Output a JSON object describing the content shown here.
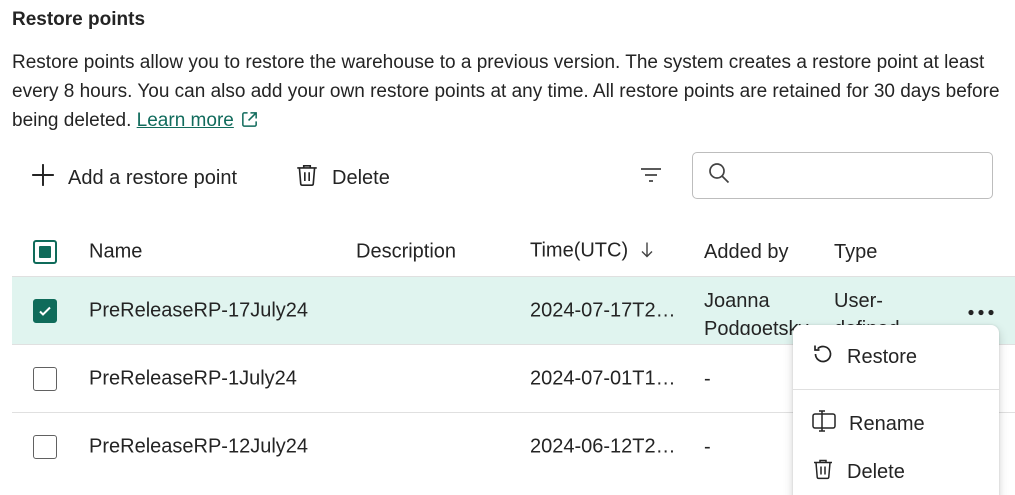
{
  "header": {
    "title": "Restore points",
    "description": "Restore points allow you to restore the warehouse to a previous version. The system creates a restore point at least every 8 hours. You can also add your own restore points at any time. All restore points are retained for 30 days before being deleted. ",
    "learn_more": "Learn more"
  },
  "toolbar": {
    "add_label": "Add a restore point",
    "delete_label": "Delete",
    "search_placeholder": ""
  },
  "table": {
    "columns": {
      "name": "Name",
      "description": "Description",
      "time": "Time(UTC)",
      "added_by": "Added by",
      "type": "Type"
    },
    "rows": [
      {
        "name": "PreReleaseRP-17July24",
        "description": "",
        "time": "2024-07-17T2…",
        "added_by": "Joanna Podgoetsky",
        "type": "User-defined",
        "checked": true
      },
      {
        "name": "PreReleaseRP-1July24",
        "description": "",
        "time": "2024-07-01T1…",
        "added_by": "-",
        "type": "",
        "checked": false
      },
      {
        "name": "PreReleaseRP-12July24",
        "description": "",
        "time": "2024-06-12T2…",
        "added_by": "-",
        "type": "",
        "checked": false
      }
    ]
  },
  "context_menu": {
    "restore": "Restore",
    "rename": "Rename",
    "delete": "Delete"
  },
  "colors": {
    "accent": "#0f6b5a",
    "selected_row": "#e0f4ef",
    "link": "#116b5c"
  }
}
